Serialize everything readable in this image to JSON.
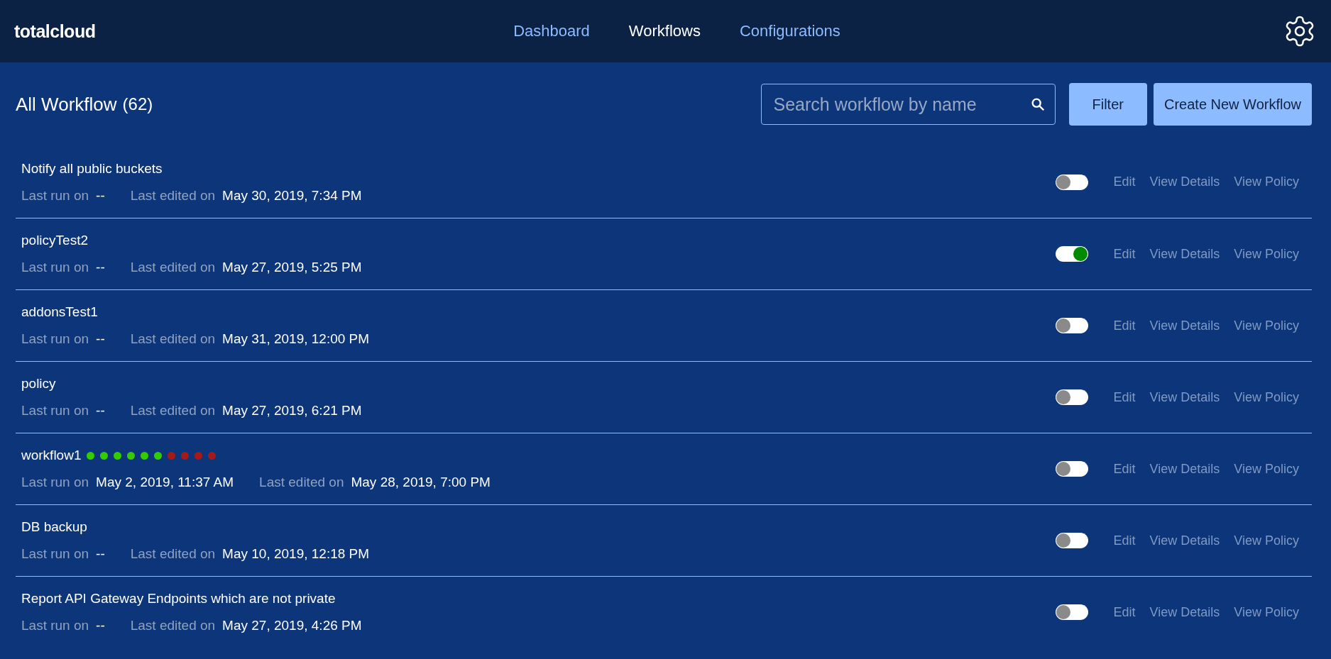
{
  "header": {
    "logo": "totalcloud",
    "nav": [
      {
        "label": "Dashboard",
        "selected": false
      },
      {
        "label": "Workflows",
        "selected": true
      },
      {
        "label": "Configurations",
        "selected": false
      }
    ]
  },
  "toolbar": {
    "title": "All Workflow",
    "count": "(62)",
    "search": {
      "placeholder": "Search workflow by name"
    },
    "buttons": [
      "Filter",
      "Create New Workflow"
    ]
  },
  "workflows": [
    {
      "name": "Notify all public buckets",
      "last_run_label": "Last run on",
      "last_run": "--",
      "last_edited_label": "Last edited on",
      "last_edited": "May 30, 2019, 7:34 PM",
      "on": false,
      "actions": [
        "Edit",
        "View Details",
        "View Policy"
      ]
    },
    {
      "name": "policyTest2",
      "last_run_label": "Last run on",
      "last_run": "--",
      "last_edited_label": "Last edited on",
      "last_edited": "May 27, 2019, 5:25 PM",
      "on": true,
      "actions": [
        "Edit",
        "View Details",
        "View Policy"
      ]
    },
    {
      "name": "addonsTest1",
      "last_run_label": "Last run on",
      "last_run": "--",
      "last_edited_label": "Last edited on",
      "last_edited": "May 31, 2019, 12:00 PM",
      "on": false,
      "actions": [
        "Edit",
        "View Details",
        "View Policy"
      ]
    },
    {
      "name": "policy",
      "last_run_label": "Last run on",
      "last_run": "--",
      "last_edited_label": "Last edited on",
      "last_edited": "May 27, 2019, 6:21 PM",
      "on": false,
      "actions": [
        "Edit",
        "View Details",
        "View Policy"
      ]
    },
    {
      "name": "workflow1",
      "runs": [
        {
          "color": "#33cc00"
        },
        {
          "color": "#33cc00"
        },
        {
          "color": "#33cc00"
        },
        {
          "color": "#33cc00"
        },
        {
          "color": "#33cc00"
        },
        {
          "color": "#33cc00"
        },
        {
          "color": "#a31a1a"
        },
        {
          "color": "#a31a1a"
        },
        {
          "color": "#a31a1a"
        },
        {
          "color": "#a31a1a"
        }
      ],
      "last_run_label": "Last run on",
      "last_run": "May 2, 2019, 11:37 AM",
      "last_edited_label": "Last edited on",
      "last_edited": "May 28, 2019, 7:00 PM",
      "on": false,
      "actions": [
        "Edit",
        "View Details",
        "View Policy"
      ]
    },
    {
      "name": "DB backup",
      "last_run_label": "Last run on",
      "last_run": "--",
      "last_edited_label": "Last edited on",
      "last_edited": "May 10, 2019, 12:18 PM",
      "on": false,
      "actions": [
        "Edit",
        "View Details",
        "View Policy"
      ]
    },
    {
      "name": "Report API Gateway Endpoints which are not private",
      "last_run_label": "Last run on",
      "last_run": "--",
      "last_edited_label": "Last edited on",
      "last_edited": "May 27, 2019, 4:26 PM",
      "on": false,
      "actions": [
        "Edit",
        "View Details",
        "View Policy"
      ]
    }
  ]
}
